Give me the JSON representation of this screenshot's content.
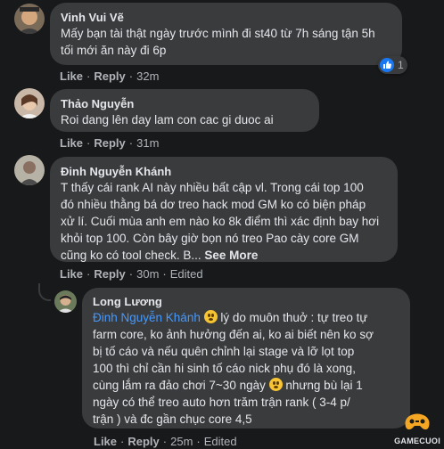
{
  "comments": [
    {
      "author": "Vinh Vui Vẽ",
      "lines": "Mấy bạn tài thật ngày trước mình đi st40 từ 7h sáng tận 5h\ntối mới ăn này đi 6p",
      "like": "Like",
      "reply": "Reply",
      "time": "32m",
      "reaction_count": "1"
    },
    {
      "author": "Thảo Nguyễn",
      "lines": "Roi dang lên day lam con cac gi duoc ai",
      "like": "Like",
      "reply": "Reply",
      "time": "31m"
    },
    {
      "author": "Đinh Nguyễn Khánh",
      "lines": "T thấy cái rank AI này nhiều bất cập vl. Trong cái top 100\nđó nhiều thằng bá dơ treo hack mod GM ko có biện pháp\nxử lí. Cuối mùa anh em nào ko 8k điểm thì xác định bay hơi\nkhỏi top 100. Còn bây giờ bọn nó treo Pao cày core GM\ncũng ko có tool check. B...",
      "see_more": "See More",
      "like": "Like",
      "reply": "Reply",
      "time": "30m",
      "edited": "Edited"
    },
    {
      "author": "Long Lương",
      "mention": "Đinh Nguyễn Khánh",
      "line1_rest": " lý do muôn thuở : tự treo tự",
      "lines": "farm core, ko ảnh hưởng đến ai, ko ai biết nên ko sợ\nbị tố cáo và nếu quên chỉnh lại stage và lỡ lọt top\n100 thì chỉ cần hi sinh tố cáo nick phụ đó là xong,",
      "line5_start": "cùng lắm ra đảo chơi 7~30 ngày ",
      "line5_end": " nhưng bù lại 1",
      "lines_end": "ngày có thể treo auto hơn trăm trận rank ( 3-4 p/\ntrận ) và đc gần chục core 4,5",
      "like": "Like",
      "reply": "Reply",
      "time": "25m",
      "edited": "Edited"
    }
  ],
  "separator": "·",
  "watermark": "GAMECUOI",
  "colors": {
    "background": "#18191a",
    "bubble": "#3a3b3c",
    "text": "#e4e6eb",
    "secondary": "#b0b3b8",
    "mention": "#4599ff",
    "like_reaction": "#1877f2"
  },
  "icons": [
    "like-reaction-icon",
    "grimacing-emoji-icon",
    "gamecuoi-logo-icon"
  ]
}
